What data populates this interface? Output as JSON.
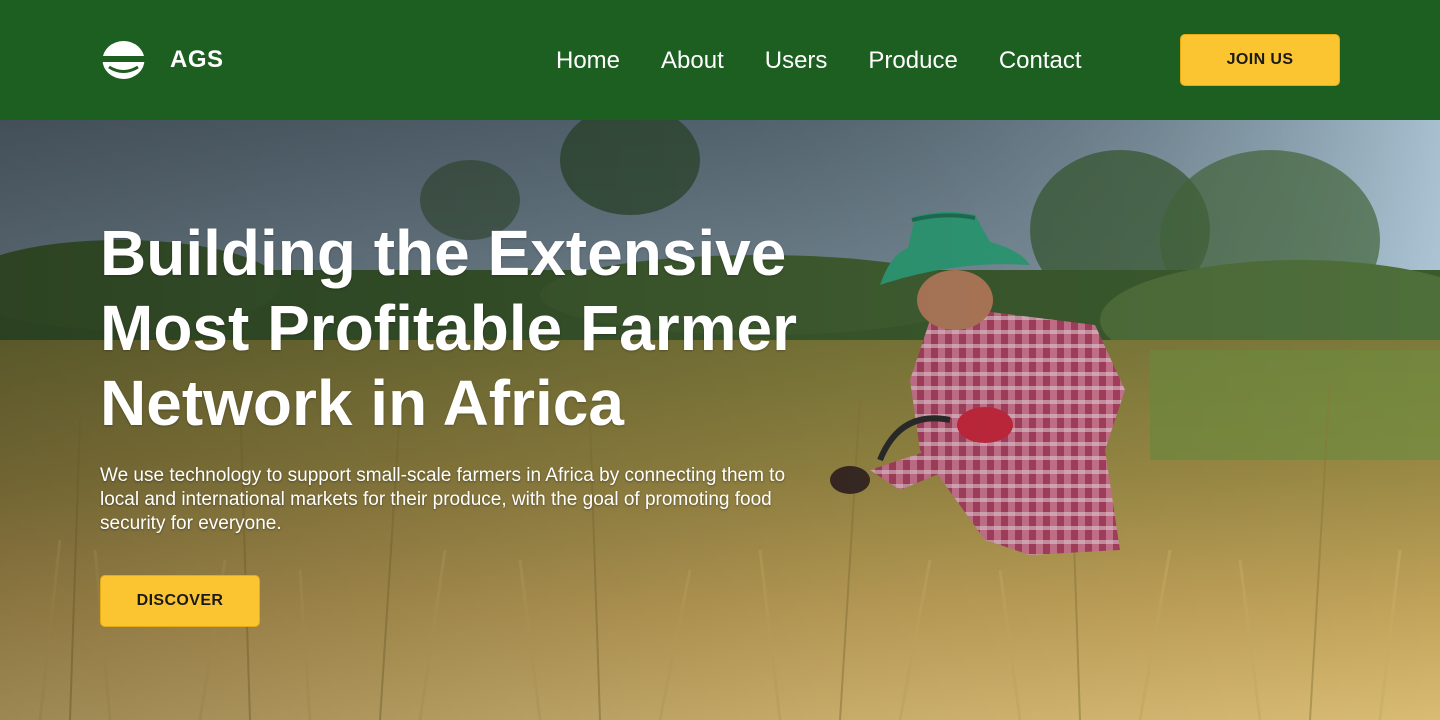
{
  "brand": {
    "name": "AGS",
    "logo_icon": "globe-half-icon"
  },
  "nav": {
    "links": [
      "Home",
      "About",
      "Users",
      "Produce",
      "Contact"
    ],
    "cta_label": "JOIN US"
  },
  "hero": {
    "title": "Building the Extensive Most Profitable Farmer Network in Africa",
    "subtitle": "We use technology to support small-scale farmers in Africa by connecting them to local and international markets for their produce, with the goal of promoting food security for everyone.",
    "cta_label": "DISCOVER",
    "background": "photo-farmer-harvesting-rice-field"
  },
  "colors": {
    "nav_bg": "#1d5f20",
    "accent": "#fbc531",
    "text_light": "#ffffff",
    "button_text": "#1a1a1a"
  }
}
